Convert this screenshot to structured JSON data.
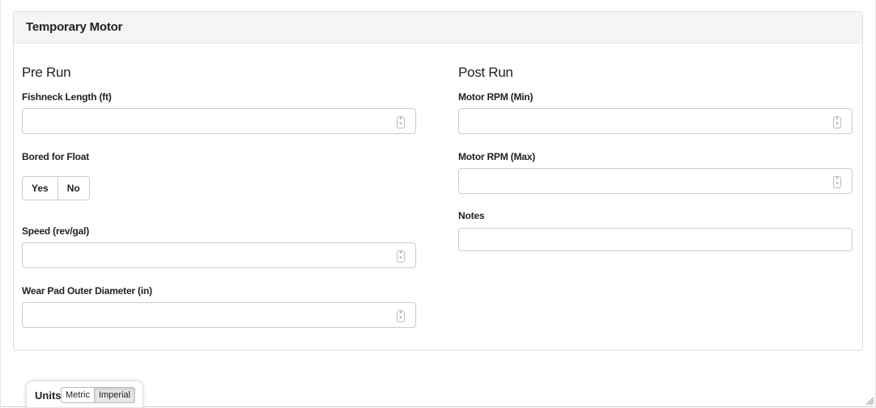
{
  "panel": {
    "title": "Temporary Motor"
  },
  "pre_run": {
    "title": "Pre Run",
    "fishneck_length": {
      "label": "Fishneck Length (ft)",
      "value": ""
    },
    "bored_for_float": {
      "label": "Bored for Float",
      "options": [
        "Yes",
        "No"
      ],
      "selected": null
    },
    "speed": {
      "label": "Speed (rev/gal)",
      "value": ""
    },
    "wear_pad_od": {
      "label": "Wear Pad Outer Diameter (in)",
      "value": ""
    }
  },
  "post_run": {
    "title": "Post Run",
    "motor_rpm_min": {
      "label": "Motor RPM (Min)",
      "value": ""
    },
    "motor_rpm_max": {
      "label": "Motor RPM (Max)",
      "value": ""
    },
    "notes": {
      "label": "Notes",
      "value": ""
    }
  },
  "units": {
    "label": "Units",
    "options": [
      "Metric",
      "Imperial"
    ],
    "selected": "Imperial"
  },
  "icons": {
    "spinner": "number-spinner-icon",
    "resize": "resize-handle-icon"
  }
}
